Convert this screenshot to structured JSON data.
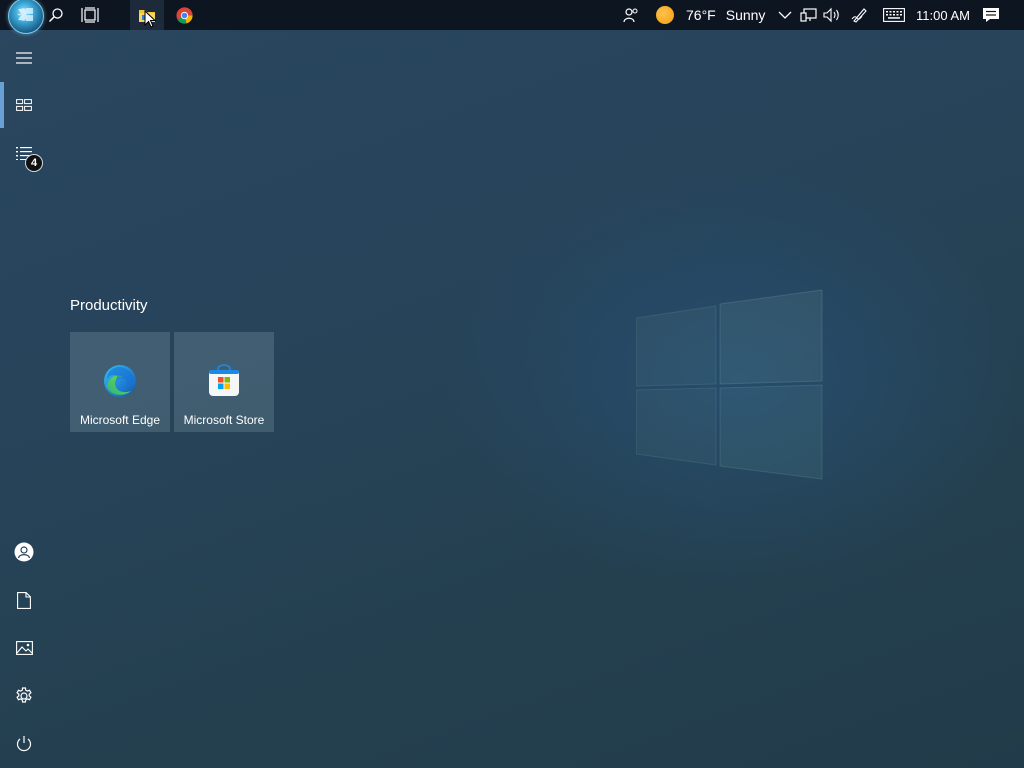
{
  "taskbar": {
    "start_icon": "windows-orb-icon",
    "search_icon": "search-icon",
    "taskview_icon": "task-view-icon",
    "pinned_apps": [
      {
        "name": "File Explorer",
        "icon": "folder-icon"
      },
      {
        "name": "Google Chrome",
        "icon": "chrome-icon"
      }
    ],
    "tray": {
      "people_icon": "people-icon",
      "weather_icon": "sun-icon",
      "temperature": "76°F",
      "condition": "Sunny",
      "chevron_icon": "chevron-up-icon",
      "network_icon": "network-icon",
      "volume_icon": "volume-icon",
      "pen_icon": "pen-icon",
      "keyboard_icon": "keyboard-icon",
      "time": "11:00 AM",
      "notifications_icon": "action-center-icon"
    }
  },
  "start_menu": {
    "rail_top": [
      {
        "name": "menu",
        "icon": "hamburger-icon"
      },
      {
        "name": "all-tiles",
        "icon": "tiles-icon",
        "active": true
      },
      {
        "name": "all-apps",
        "icon": "list-icon",
        "badge": "4"
      }
    ],
    "rail_bottom": [
      {
        "name": "account",
        "icon": "user-icon"
      },
      {
        "name": "documents",
        "icon": "document-icon"
      },
      {
        "name": "pictures",
        "icon": "pictures-icon"
      },
      {
        "name": "settings",
        "icon": "gear-icon"
      },
      {
        "name": "power",
        "icon": "power-icon"
      }
    ],
    "group_title": "Productivity",
    "tiles": [
      {
        "label": "Microsoft Edge",
        "icon": "edge-icon"
      },
      {
        "label": "Microsoft Store",
        "icon": "store-icon"
      }
    ]
  },
  "colors": {
    "taskbar_bg": "#0d1520",
    "accent": "#6aa0d6",
    "desktop_bg": "#27445b"
  }
}
